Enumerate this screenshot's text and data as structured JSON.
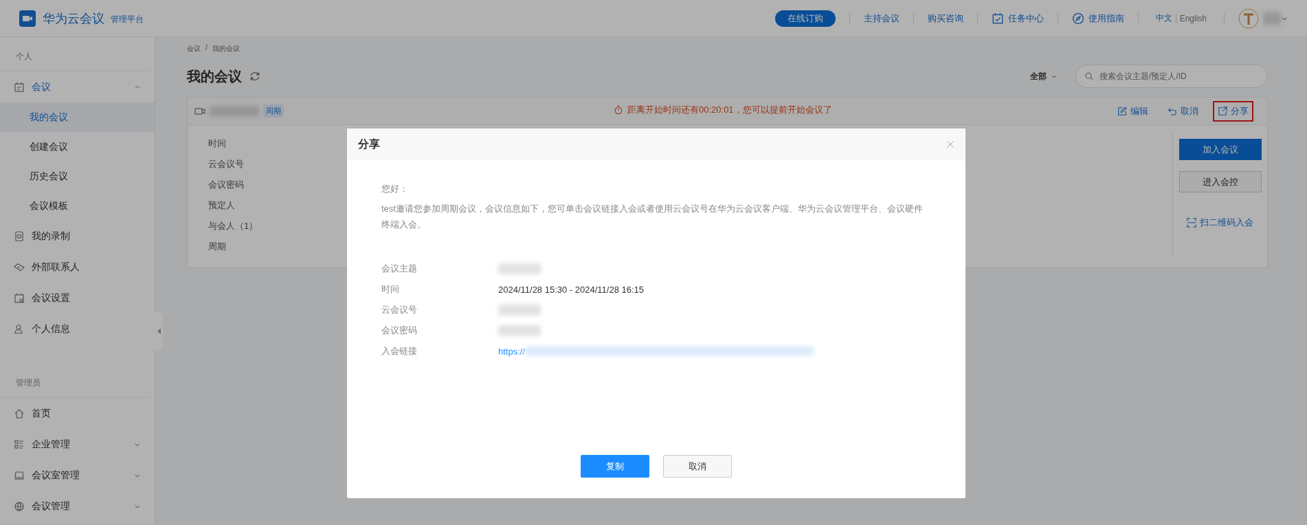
{
  "header": {
    "brand": "华为云会议",
    "subtitle": "管理平台",
    "nav": [
      {
        "label": "在线订购",
        "kind": "pill"
      },
      {
        "label": "主持会议",
        "kind": "link"
      },
      {
        "label": "购买咨询",
        "kind": "link"
      },
      {
        "label": "任务中心",
        "kind": "task"
      },
      {
        "label": "使用指南",
        "kind": "guide"
      }
    ],
    "languages": [
      {
        "label": "中文",
        "selected": true
      },
      {
        "label": "English",
        "selected": false
      }
    ]
  },
  "sidebar": {
    "sections": [
      {
        "label": "个人",
        "items": [
          {
            "label": "会议",
            "expanded": true,
            "children": [
              {
                "label": "我的会议",
                "selected": true
              },
              {
                "label": "创建会议",
                "selected": false
              },
              {
                "label": "历史会议",
                "selected": false
              },
              {
                "label": "会议模板",
                "selected": false
              }
            ]
          },
          {
            "label": "我的录制"
          },
          {
            "label": "外部联系人"
          },
          {
            "label": "会议设置"
          },
          {
            "label": "个人信息"
          }
        ]
      },
      {
        "label": "管理员",
        "items": [
          {
            "label": "首页"
          },
          {
            "label": "企业管理",
            "expanded": false
          },
          {
            "label": "会议室管理",
            "expanded": false
          },
          {
            "label": "会议管理",
            "expanded": false
          }
        ]
      }
    ]
  },
  "main": {
    "breadcrumb": [
      "会议",
      "我的会议"
    ],
    "breadcrumb_separator": "/",
    "title": "我的会议",
    "filter": "全部",
    "search": {
      "placeholder": "搜索会议主题/预定人/ID"
    },
    "meeting": {
      "tag": "周期",
      "countdown": "距离开始时间还有00:20:01，您可以提前开始会议了",
      "actions": [
        {
          "label": "编辑",
          "highlighted": false
        },
        {
          "label": "取消",
          "highlighted": false
        },
        {
          "label": "分享",
          "highlighted": true
        }
      ],
      "details": [
        "时间",
        "云会议号",
        "会议密码",
        "预定人",
        "与会人（1）",
        "周期"
      ],
      "buttons": [
        {
          "label": "加入会议",
          "kind": "primary"
        },
        {
          "label": "进入会控",
          "kind": "default"
        },
        {
          "label": "扫二维码入会",
          "kind": "link"
        }
      ]
    }
  },
  "dialog": {
    "title": "分享",
    "greeting": "您好：",
    "message": "test邀请您参加周期会议，会议信息如下，您可单击会议链接入会或者使用云会议号在华为云会议客户端、华为云会议管理平台、会议硬件终端入会。",
    "fields": [
      {
        "label": "会议主题",
        "kind": "blurred"
      },
      {
        "label": "时间",
        "kind": "text",
        "value": "2024/11/28 15:30 - 2024/11/28 16:15"
      },
      {
        "label": "云会议号",
        "kind": "blurred"
      },
      {
        "label": "会议密码",
        "kind": "blurred"
      },
      {
        "label": "入会链接",
        "kind": "link",
        "value": "https://"
      }
    ],
    "buttons": [
      {
        "label": "复制",
        "kind": "primary"
      },
      {
        "label": "取消",
        "kind": "default"
      }
    ]
  }
}
